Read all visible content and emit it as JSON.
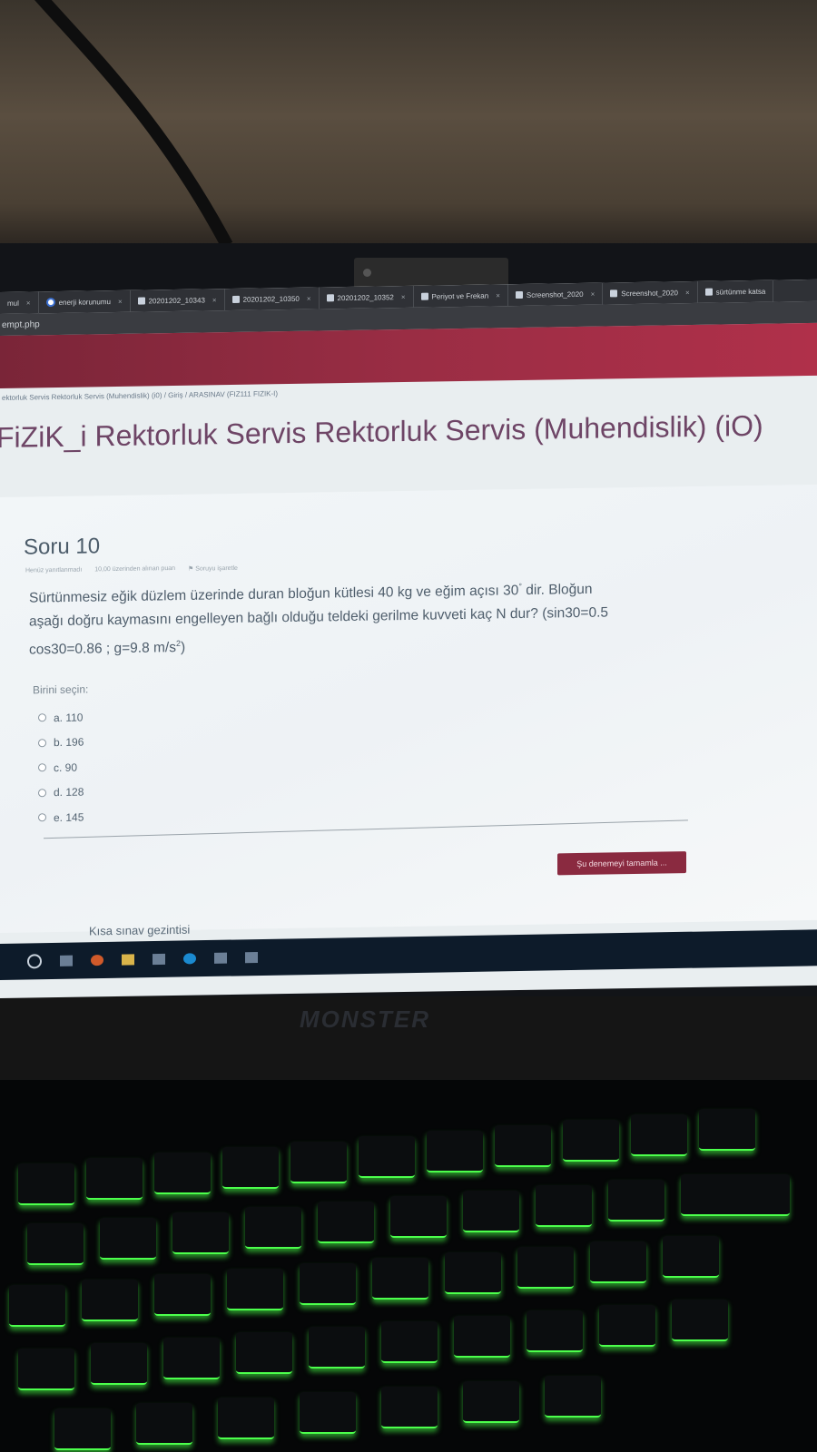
{
  "browser": {
    "tabs": [
      {
        "label": "mul",
        "icon": "page-icon"
      },
      {
        "label": "enerji korunumu",
        "icon": "google-icon"
      },
      {
        "label": "20201202_10343",
        "icon": "image-file-icon"
      },
      {
        "label": "20201202_10350",
        "icon": "image-file-icon"
      },
      {
        "label": "20201202_10352",
        "icon": "image-file-icon"
      },
      {
        "label": "Periyot ve Frekan",
        "icon": "page-icon"
      },
      {
        "label": "Screenshot_2020",
        "icon": "image-file-icon"
      },
      {
        "label": "Screenshot_2020",
        "icon": "image-file-icon"
      },
      {
        "label": "sürtünme katsa",
        "icon": "page-icon"
      }
    ],
    "url": "empt.php"
  },
  "breadcrumb": "ektorluk Servis Rektorluk Servis (Muhendislik) (i0)  /  Giriş  /  ARASINAV (FIZ111 FIZIK-I)",
  "course_title": "FiZiK_i Rektorluk Servis Rektorluk Servis (Muhendislik) (iO)",
  "question": {
    "number": "Soru 10",
    "status": "Henüz yanıtlanmadı",
    "points": "10,00 üzerinden alınan puan",
    "flag": "Soruyu işaretle",
    "text_line1": "Sürtünmesiz eğik düzlem üzerinde duran bloğun kütlesi 40 kg ve eğim açısı 30",
    "text_line1_end": " dir. Bloğun",
    "text_line2": "aşağı doğru kaymasını engelleyen bağlı olduğu teldeki gerilme kuvveti kaç N dur? (sin30=0.5",
    "text_line3": "cos30=0.86 ;  g=9.8 m/s",
    "text_line3_end": ")",
    "prompt": "Birini seçin:",
    "options": [
      "a. 110",
      "b. 196",
      "c. 90",
      "d. 128",
      "e. 145"
    ]
  },
  "finish_button": "Şu denemeyi tamamla ...",
  "nav_link": "Kısa sınav gezintisi",
  "laptop_brand": "MONSTER",
  "colors": {
    "banner": "#9a2d44",
    "title": "#6e4566",
    "button": "#8a2a40",
    "key_glow": "#4cff4c"
  }
}
